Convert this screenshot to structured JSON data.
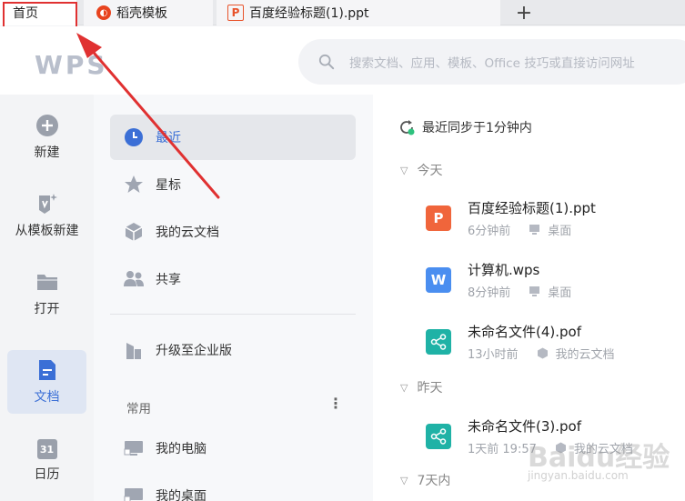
{
  "tabs": {
    "home": "首页",
    "daoke": "稻壳模板",
    "ppt": "百度经验标题(1).ppt",
    "add": "+"
  },
  "header": {
    "logo": "WPS",
    "search_placeholder": "搜索文档、应用、模板、Office 技巧或直接访问网址"
  },
  "rail": {
    "new": "新建",
    "from_template": "从模板新建",
    "open": "打开",
    "docs": "文档",
    "calendar": "日历",
    "calendar_day": "31"
  },
  "nav": {
    "recent": "最近",
    "starred": "星标",
    "cloud_docs": "我的云文档",
    "shared": "共享",
    "upgrade": "升级至企业版",
    "common_section": "常用",
    "more": "⋮",
    "my_computer": "我的电脑",
    "my_desktop": "我的桌面"
  },
  "main": {
    "sync_status": "最近同步于1分钟内",
    "groups": {
      "today": "今天",
      "yesterday": "昨天",
      "seven_days": "7天内"
    },
    "files": [
      {
        "name": "百度经验标题(1).ppt",
        "time": "6分钟前",
        "location": "桌面",
        "type_glyph": "P"
      },
      {
        "name": "计算机.wps",
        "time": "8分钟前",
        "location": "桌面",
        "type_glyph": "W"
      },
      {
        "name": "未命名文件(4).pof",
        "time": "13小时前",
        "location": "我的云文档",
        "type_glyph": "⋖"
      },
      {
        "name": "未命名文件(3).pof",
        "time": "1天前 19:57",
        "location": "我的云文档",
        "type_glyph": "⋖"
      }
    ]
  },
  "watermark": {
    "text": "Baidu经验",
    "url": "jingyan.baidu.com"
  },
  "colors": {
    "accent": "#3b6fd6",
    "highlight_red": "#e03131",
    "ppt_orange": "#f0653b",
    "wps_blue": "#4a8ef0",
    "pof_teal": "#1fb2a6"
  }
}
